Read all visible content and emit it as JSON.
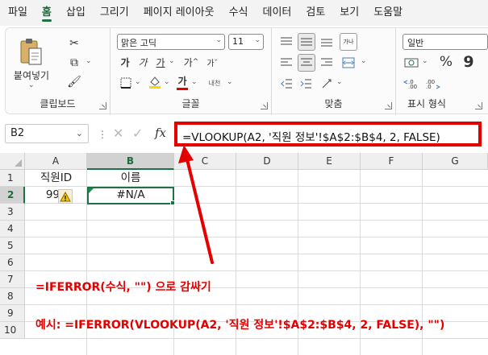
{
  "menu": {
    "tabs": [
      "파일",
      "홈",
      "삽입",
      "그리기",
      "페이지 레이아웃",
      "수식",
      "데이터",
      "검토",
      "보기",
      "도움말"
    ],
    "active": "홈"
  },
  "ribbon": {
    "clipboard": {
      "label": "클립보드",
      "paste_label": "붙여넣기"
    },
    "font": {
      "label": "글꼴",
      "font_name": "맑은 고딕",
      "font_size": "11",
      "bold": "가",
      "italic": "가",
      "underline": "가",
      "grow": "가",
      "shrink": "가",
      "font_color_glyph": "가",
      "phonetic": "내천"
    },
    "alignment": {
      "label": "맞춤",
      "wrap_glyph": "가나"
    },
    "number": {
      "label": "표시 형식",
      "format": "일반",
      "percent": "%",
      "comma": "9"
    }
  },
  "formula_bar": {
    "name_box": "B2",
    "fx": "fx",
    "formula": "=VLOOKUP(A2, '직원 정보'!$A$2:$B$4, 2, FALSE)"
  },
  "grid": {
    "columns": [
      "A",
      "B",
      "C",
      "D",
      "E",
      "F",
      "G"
    ],
    "rows": [
      "1",
      "2",
      "3",
      "4",
      "5",
      "6",
      "7",
      "8",
      "9",
      "10"
    ],
    "cells": {
      "A1": "직원ID",
      "B1": "이름",
      "A2": "99",
      "B2": "#N/A"
    },
    "selected_cell": "B2"
  },
  "annotations": {
    "line1": "=IFERROR(수식, \"\") 으로 감싸기",
    "line2": "예시: =IFERROR(VLOOKUP(A2, '직원 정보'!$A$2:$B$4, 2, FALSE), \"\")",
    "color": "#e50000"
  },
  "colors": {
    "accent": "#1e7145",
    "highlight": "#e50000"
  }
}
